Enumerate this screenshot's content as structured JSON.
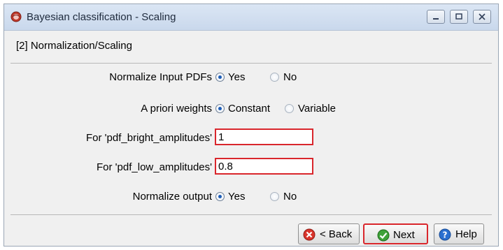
{
  "window": {
    "title": "Bayesian classification - Scaling",
    "icon": "app-logo-icon",
    "controls": [
      "minimize-icon",
      "maximize-icon",
      "close-icon"
    ]
  },
  "section": {
    "title": "[2] Normalization/Scaling"
  },
  "form": {
    "normalize_input": {
      "label": "Normalize Input PDFs",
      "options": [
        "Yes",
        "No"
      ],
      "selected": "Yes"
    },
    "apriori_weights": {
      "label": "A priori weights",
      "options": [
        "Constant",
        "Variable"
      ],
      "selected": "Constant"
    },
    "bright": {
      "label": "For 'pdf_bright_amplitudes'",
      "value": "1"
    },
    "low": {
      "label": "For 'pdf_low_amplitudes'",
      "value": "0.8"
    },
    "normalize_output": {
      "label": "Normalize output",
      "options": [
        "Yes",
        "No"
      ],
      "selected": "Yes"
    }
  },
  "buttons": {
    "back": "< Back",
    "next": "Next",
    "help": "Help"
  },
  "colors": {
    "highlight": "#d9262c",
    "radio_selected": "#1c5db8",
    "titlebar": "#c9d8ec"
  }
}
